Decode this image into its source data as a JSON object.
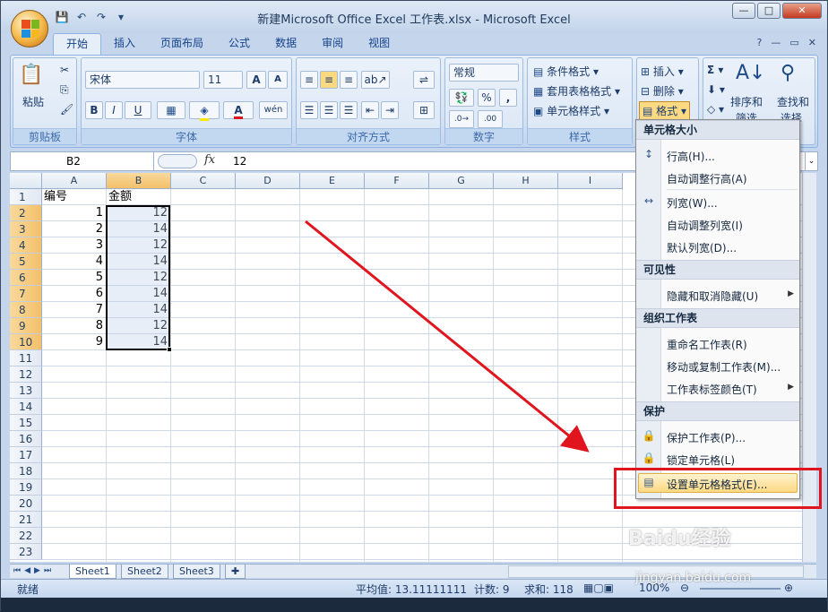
{
  "window": {
    "title": "新建Microsoft Office Excel 工作表.xlsx - Microsoft Excel",
    "controls": [
      "—",
      "□",
      "✕"
    ]
  },
  "ribbon_tabs": [
    "开始",
    "插入",
    "页面布局",
    "公式",
    "数据",
    "审阅",
    "视图"
  ],
  "ribbon": {
    "clipboard": {
      "paste": "粘贴",
      "label": "剪贴板"
    },
    "font": {
      "name": "宋体",
      "size": "11",
      "label": "字体",
      "bold": "B",
      "italic": "I",
      "underline": "U",
      "grow": "A",
      "shrink": "A",
      "color_a": "A",
      "wen": "wén"
    },
    "alignment": {
      "label": "对齐方式"
    },
    "number": {
      "format": "常规",
      "percent": "%",
      "comma": ",",
      "label": "数字"
    },
    "styles": {
      "conditional": "条件格式",
      "table": "套用表格格式",
      "cell": "单元格样式",
      "label": "样式"
    },
    "cells": {
      "insert": "插入",
      "delete": "删除",
      "format": "格式"
    },
    "editing": {
      "sort": "排序和",
      "sort2": "筛选",
      "find": "查找和",
      "find2": "选择"
    }
  },
  "formula_bar": {
    "name_box": "B2",
    "fx": "fx",
    "value": "12"
  },
  "columns": [
    "A",
    "B",
    "C",
    "D",
    "E",
    "F",
    "G",
    "H",
    "I"
  ],
  "rows": [
    "1",
    "2",
    "3",
    "4",
    "5",
    "6",
    "7",
    "8",
    "9",
    "10",
    "11",
    "12",
    "13",
    "14",
    "15",
    "16",
    "17",
    "18",
    "19",
    "20",
    "21",
    "22",
    "23"
  ],
  "cells": {
    "A1": "编号",
    "B1": "金额",
    "A_values": [
      "1",
      "2",
      "3",
      "4",
      "5",
      "6",
      "7",
      "8",
      "9"
    ],
    "B_values": [
      "12",
      "14",
      "12",
      "14",
      "12",
      "14",
      "14",
      "12",
      "14"
    ]
  },
  "sheets": [
    "Sheet1",
    "Sheet2",
    "Sheet3"
  ],
  "status": {
    "ready": "就绪",
    "average": "平均值: 13.11111111",
    "count": "计数: 9",
    "sum": "求和: 118",
    "zoom": "100%"
  },
  "menu": {
    "h1": "单元格大小",
    "row_height": "行高(H)...",
    "autofit_row": "自动调整行高(A)",
    "col_width": "列宽(W)...",
    "autofit_col": "自动调整列宽(I)",
    "default_width": "默认列宽(D)...",
    "h2": "可见性",
    "hide_unhide": "隐藏和取消隐藏(U)",
    "h3": "组织工作表",
    "rename": "重命名工作表(R)",
    "move_copy": "移动或复制工作表(M)...",
    "tab_color": "工作表标签颜色(T)",
    "h4": "保护",
    "protect": "保护工作表(P)...",
    "lock": "锁定单元格(L)",
    "format_cells": "设置单元格格式(E)..."
  },
  "watermark": {
    "brand": "Baidu经验",
    "url": "jingyan.baidu.com"
  },
  "colors": {
    "accent_red": "#e0151d",
    "selection": "#f3c06a"
  }
}
